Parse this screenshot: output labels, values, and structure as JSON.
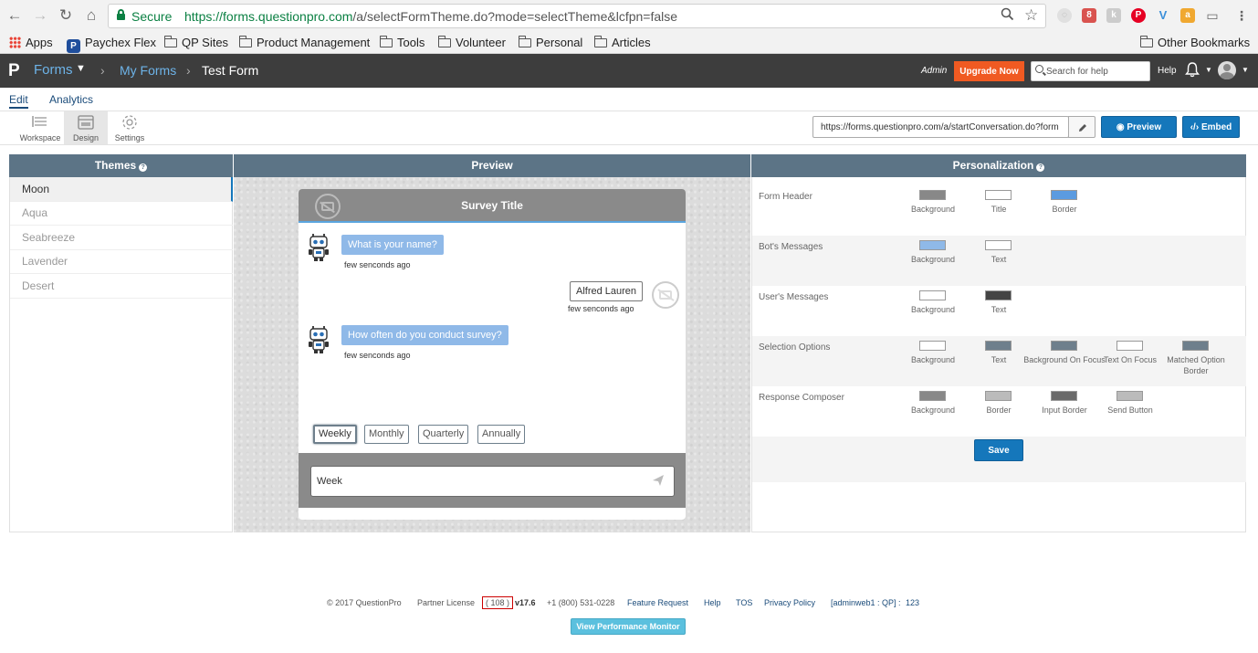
{
  "browser": {
    "secure_label": "Secure",
    "url_host": "https://forms.questionpro.com",
    "url_path": "/a/selectFormTheme.do?mode=selectTheme&lcfpn=false",
    "extension_badge": "8",
    "bookmarks": [
      {
        "label": "Apps",
        "icon": "apps-grid-icon"
      },
      {
        "label": "Paychex Flex",
        "icon": "paychex-icon"
      },
      {
        "label": "QP Sites",
        "icon": "folder-icon"
      },
      {
        "label": "Product Management",
        "icon": "folder-icon"
      },
      {
        "label": "Tools",
        "icon": "folder-icon"
      },
      {
        "label": "Volunteer",
        "icon": "folder-icon"
      },
      {
        "label": "Personal",
        "icon": "folder-icon"
      },
      {
        "label": "Articles",
        "icon": "folder-icon"
      }
    ],
    "other_bookmarks": "Other Bookmarks"
  },
  "header": {
    "logo": "P",
    "forms": "Forms",
    "my_forms": "My Forms",
    "form_name": "Test Form",
    "admin": "Admin",
    "upgrade": "Upgrade Now",
    "search_placeholder": "Search for help",
    "help": "Help"
  },
  "subnav": {
    "tabs": [
      "Edit",
      "Analytics"
    ],
    "tools": [
      "Workspace",
      "Design",
      "Settings"
    ],
    "form_url": "https://forms.questionpro.com/a/startConversation.do?form",
    "preview": "Preview",
    "embed": "Embed"
  },
  "themes": {
    "title": "Themes",
    "items": [
      "Moon",
      "Aqua",
      "Seabreeze",
      "Lavender",
      "Desert"
    ],
    "selected": "Moon"
  },
  "preview": {
    "title": "Preview",
    "survey_title": "Survey Title",
    "messages": [
      {
        "from": "bot",
        "text": "What is your name?",
        "time": "few senconds ago"
      },
      {
        "from": "user",
        "text": "Alfred Lauren",
        "time": "few senconds ago"
      },
      {
        "from": "bot",
        "text": "How often do you conduct survey?",
        "time": "few senconds ago"
      }
    ],
    "options": [
      "Weekly",
      "Monthly",
      "Quarterly",
      "Annually"
    ],
    "selected_option": "Weekly",
    "composer_value": "Week"
  },
  "personalization": {
    "title": "Personalization",
    "sections": [
      {
        "label": "Form Header",
        "swatches": [
          {
            "label": "Background",
            "color": "#888888"
          },
          {
            "label": "Title",
            "color": "#ffffff"
          },
          {
            "label": "Border",
            "color": "#5b9be0"
          }
        ]
      },
      {
        "label": "Bot's Messages",
        "swatches": [
          {
            "label": "Background",
            "color": "#8fb9e8"
          },
          {
            "label": "Text",
            "color": "#ffffff"
          }
        ]
      },
      {
        "label": "User's Messages",
        "swatches": [
          {
            "label": "Background",
            "color": "#ffffff"
          },
          {
            "label": "Text",
            "color": "#444444"
          }
        ]
      },
      {
        "label": "Selection Options",
        "swatches": [
          {
            "label": "Background",
            "color": "#ffffff"
          },
          {
            "label": "Text",
            "color": "#6e7f8c"
          },
          {
            "label": "Background On Focus",
            "color": "#6e7f8c"
          },
          {
            "label": "Text On Focus",
            "color": "#ffffff"
          },
          {
            "label": "Matched Option Border",
            "color": "#6e7f8c"
          }
        ]
      },
      {
        "label": "Response Composer",
        "swatches": [
          {
            "label": "Background",
            "color": "#888888"
          },
          {
            "label": "Border",
            "color": "#bbbbbb"
          },
          {
            "label": "Input Border",
            "color": "#6a6a6a"
          },
          {
            "label": "Send Button",
            "color": "#bbbbbb"
          }
        ]
      }
    ],
    "save": "Save"
  },
  "footer": {
    "copyright": "© 2017 QuestionPro",
    "partner_license": "Partner License",
    "license_num": "( 108 )",
    "version": "v17.6",
    "phone": "+1 (800) 531-0228",
    "feature_request": "Feature Request",
    "help": "Help",
    "tos": "TOS",
    "privacy": "Privacy Policy",
    "server": "[adminweb1 : QP] :",
    "server_num": "123",
    "perf_monitor": "View Performance Monitor"
  }
}
